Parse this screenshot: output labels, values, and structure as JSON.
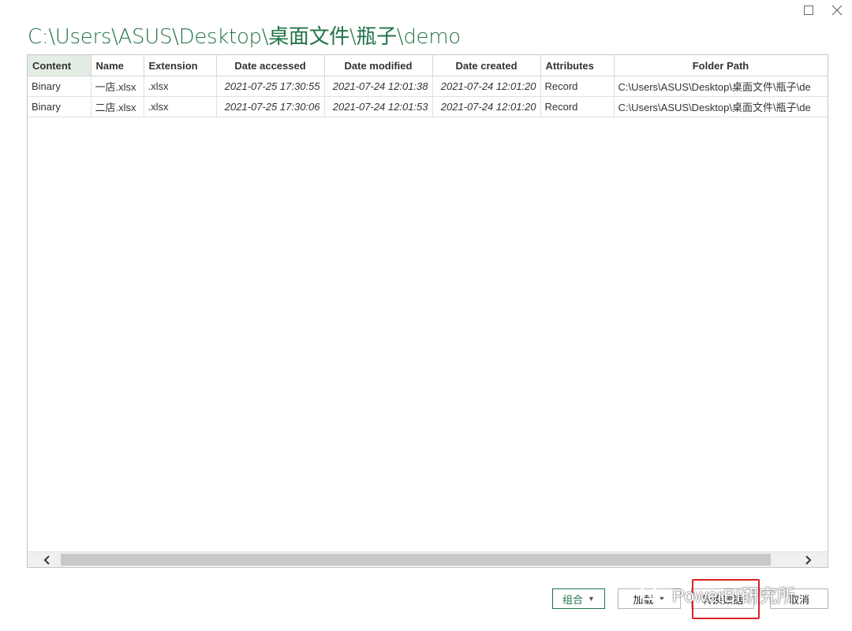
{
  "window": {
    "title": "C:\\Users\\ASUS\\Desktop\\桌面文件\\瓶子\\demo",
    "controls": [
      "maximize-icon",
      "close-icon"
    ]
  },
  "table": {
    "columns": [
      "Content",
      "Name",
      "Extension",
      "Date accessed",
      "Date modified",
      "Date created",
      "Attributes",
      "Folder Path"
    ],
    "rows": [
      [
        "Binary",
        "一店.xlsx",
        ".xlsx",
        "2021-07-25 17:30:55",
        "2021-07-24 12:01:38",
        "2021-07-24 12:01:20",
        "Record",
        "C:\\Users\\ASUS\\Desktop\\桌面文件\\瓶子\\de"
      ],
      [
        "Binary",
        "二店.xlsx",
        ".xlsx",
        "2021-07-25 17:30:06",
        "2021-07-24 12:01:53",
        "2021-07-24 12:01:20",
        "Record",
        "C:\\Users\\ASUS\\Desktop\\桌面文件\\瓶子\\de"
      ]
    ]
  },
  "buttons": {
    "combine": "组合",
    "load": "加载",
    "transform": "转换数据",
    "cancel": "取消"
  },
  "watermark": {
    "text": "PowerBI研究所"
  },
  "colors": {
    "accent": "#217346",
    "highlight": "#e02020",
    "header_first_bg": "#e3ede3"
  }
}
